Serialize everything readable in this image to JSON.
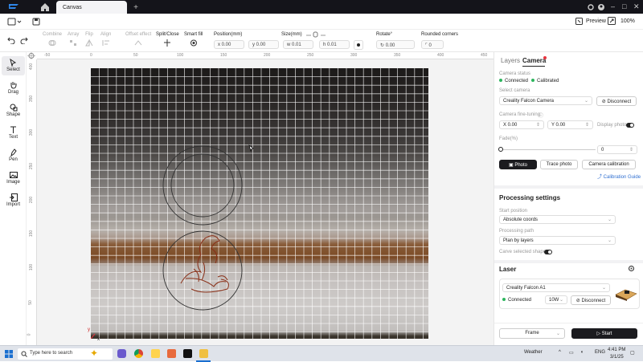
{
  "titlebar": {
    "tab_label": "Canvas",
    "add_tab": "+"
  },
  "menubar": {
    "preview_label": "Preview",
    "zoom_label": "100%"
  },
  "toolbar": {
    "combine": "Combine",
    "array": "Array",
    "flip": "Flip",
    "align": "Align",
    "offset_effect": "Offset effect",
    "split_close": "Split/Close",
    "smart_fill": "Smart fill",
    "position_label": "Position(mm)",
    "pos_x": "x  0.00",
    "pos_y": "y  0.00",
    "size_label": "Size(mm)",
    "size_w": "w  0.01",
    "size_h": "h  0.01",
    "rotate_label": "Rotate°",
    "rotate_value": "0.00",
    "rounded_label": "Rounded corners",
    "rounded_value": "0"
  },
  "sidebar": {
    "items": [
      {
        "label": "Select",
        "icon": "cursor-icon"
      },
      {
        "label": "Drag",
        "icon": "hand-icon"
      },
      {
        "label": "Shape",
        "icon": "shape-icon"
      },
      {
        "label": "Text",
        "icon": "text-icon"
      },
      {
        "label": "Pen",
        "icon": "pen-icon"
      },
      {
        "label": "Image",
        "icon": "image-icon"
      },
      {
        "label": "Import",
        "icon": "import-icon"
      }
    ]
  },
  "rulers": {
    "top": [
      "-50",
      "0",
      "50",
      "100",
      "150",
      "200",
      "250",
      "300",
      "350",
      "400",
      "450"
    ],
    "left": [
      "0",
      "50",
      "100",
      "150",
      "200",
      "250",
      "300",
      "350",
      "400"
    ],
    "origin_x": "x",
    "origin_y": "y"
  },
  "panel": {
    "tabs": {
      "layers": "Layers",
      "camera": "Camera"
    },
    "camera_status_label": "Camera status",
    "status_connected": "Connected",
    "status_calibrated": "Calibrated",
    "select_camera_label": "Select camera",
    "camera_name": "Creality Falcon Camera",
    "disconnect": "Disconnect",
    "fine_tuning_label": "Camera fine-tuning",
    "fine_x": "X  0.00",
    "fine_y": "Y  0.00",
    "display_photo": "Display photo",
    "fade_label": "Fade(%)",
    "fade_value": "0",
    "photo_btn": "Photo",
    "trace_btn": "Trace photo",
    "calib_btn": "Camera calibration",
    "calib_guide": "Calibration Guide",
    "processing_title": "Processing settings",
    "start_position_label": "Start position",
    "start_position_value": "Absolute coords",
    "processing_path_label": "Processing path",
    "processing_path_value": "Plan by layers",
    "carve_selected": "Carve selected shape",
    "laser_title": "Laser",
    "laser_device": "Creality Falcon A1",
    "laser_status": "Connected",
    "laser_power": "10W",
    "laser_disconnect": "Disconnect",
    "frame_btn": "Frame",
    "start_btn": "Start"
  },
  "taskbar": {
    "search_placeholder": "Type here to search",
    "lang": "ENG",
    "time": "4:41 PM",
    "date": "3/1/25",
    "weather": "Weather"
  },
  "colors": {
    "accent_red": "#e8343f",
    "connected_green": "#2db55d",
    "start_black": "#1b1b1f"
  }
}
